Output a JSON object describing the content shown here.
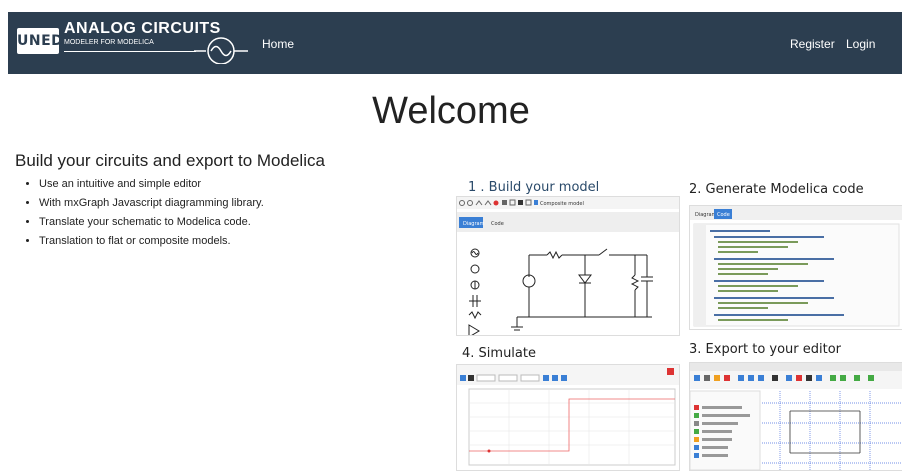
{
  "nav": {
    "logo": "UNED",
    "brand_title": "ANALOG CIRCUITS",
    "brand_subtitle": "MODELER FOR MODELICA",
    "home": "Home",
    "register": "Register",
    "login": "Login"
  },
  "main": {
    "heading": "Welcome",
    "subtitle": "Build your circuits and export to Modelica",
    "features": [
      "Use an intuitive and simple editor",
      "With mxGraph Javascript diagramming library.",
      "Translate your schematic to Modelica code.",
      "Translation to flat or composite models."
    ]
  },
  "steps": {
    "build": "1 . Build your model",
    "generate": "2. Generate Modelica code",
    "export": "3. Export to your editor",
    "simulate": "4. Simulate"
  },
  "editor_shot": {
    "toolbar_label": "Composite model",
    "tab_diagram": "Diagram",
    "tab_code": "Code"
  },
  "code_shot": {
    "tab_diagram": "Diagram",
    "tab_code": "Code"
  },
  "colors": {
    "navbar": "#2c3e50",
    "step_accent": "#2a4a6a",
    "tab_active": "#3a7fd5"
  }
}
